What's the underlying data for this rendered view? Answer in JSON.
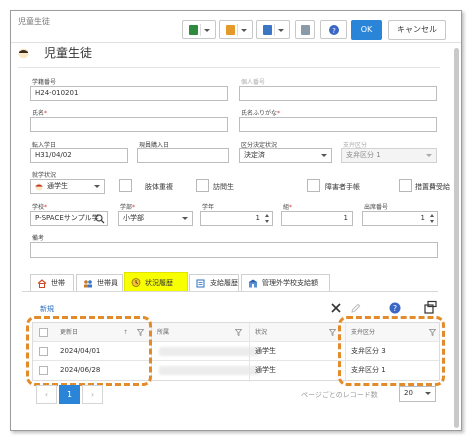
{
  "window": {
    "title": "児童生徒"
  },
  "toolbar": {
    "ok_label": "OK",
    "cancel_label": "キャンセル"
  },
  "page": {
    "title": "児童生徒"
  },
  "form": {
    "student_no": {
      "label": "学籍番号",
      "value": "H24-010201"
    },
    "personal_no": {
      "label": "個人番号",
      "value": ""
    },
    "name": {
      "label": "氏名",
      "value": ""
    },
    "name_kana": {
      "label": "氏名ふりがな",
      "value": ""
    },
    "transfer_date": {
      "label": "転入学日",
      "value": "H31/04/02"
    },
    "document_date": {
      "label": "現員購入日",
      "value": ""
    },
    "category_decision": {
      "label": "区分決定状況",
      "value": "決定済"
    },
    "support_category": {
      "label": "支弁区分",
      "value": "支弁区分 1"
    },
    "enrollment": {
      "label": "就学状況",
      "value": "通学生"
    },
    "checks": [
      {
        "label": "肢体重複"
      },
      {
        "label": "訪問生"
      },
      {
        "label": "障害者手帳"
      },
      {
        "label": "措置費受給"
      }
    ],
    "school": {
      "label": "学校",
      "value": "P-SPACEサンプル学"
    },
    "department": {
      "label": "学部",
      "value": "小学部"
    },
    "grade": {
      "label": "学年",
      "value": "1"
    },
    "class": {
      "label": "組",
      "value": "1"
    },
    "attendance_no": {
      "label": "出席番号",
      "value": "1"
    },
    "remarks": {
      "label": "備考",
      "value": ""
    }
  },
  "tabs": [
    {
      "label": "世帯",
      "icon": "home-icon"
    },
    {
      "label": "世帯員",
      "icon": "people-icon"
    },
    {
      "label": "状況履歴",
      "icon": "history-icon",
      "active": true
    },
    {
      "label": "支給履歴",
      "icon": "payment-icon"
    },
    {
      "label": "管理外学校支給額",
      "icon": "school-icon"
    }
  ],
  "grid": {
    "new_label": "新規",
    "columns": [
      "更新日",
      "所属",
      "状況",
      "支弁区分"
    ],
    "rows": [
      {
        "date": "2024/04/01",
        "status": "通学生",
        "category": "支弁区分 3"
      },
      {
        "date": "2024/06/28",
        "status": "通学生",
        "category": "支弁区分 1"
      }
    ]
  },
  "pager": {
    "current": "1",
    "per_page_label": "ページごとのレコード数",
    "per_page": "20"
  },
  "colors": {
    "accent": "#2a84d7",
    "highlight": "#e38b2b",
    "active_tab": "#f7ff00"
  }
}
